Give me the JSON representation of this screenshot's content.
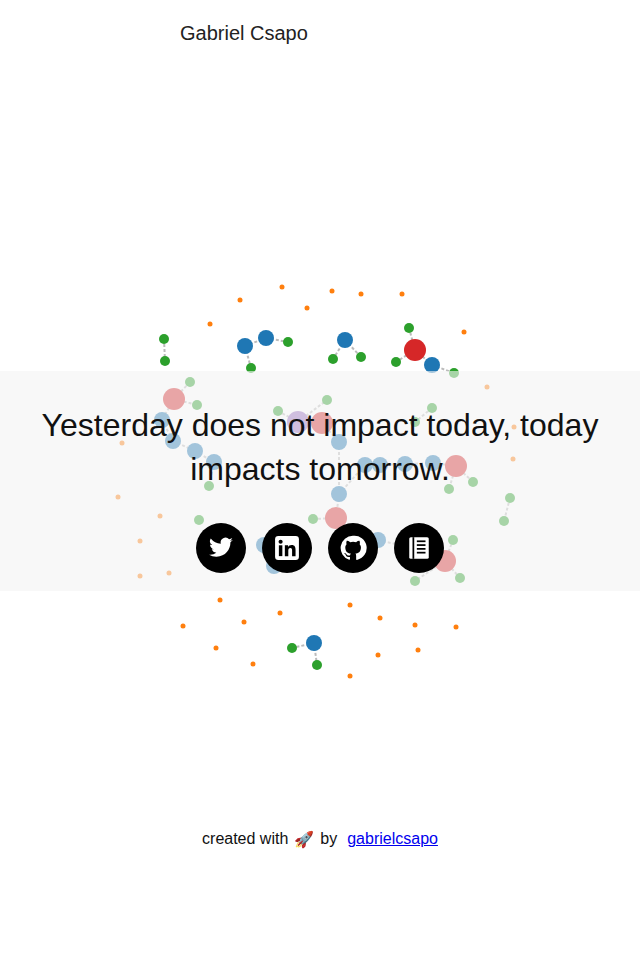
{
  "header": {
    "name": "Gabriel Csapo"
  },
  "quote": "Yesterday does not impact today, today impacts tomorrow.",
  "social": [
    {
      "network": "twitter"
    },
    {
      "network": "linkedin"
    },
    {
      "network": "github"
    },
    {
      "network": "blog"
    }
  ],
  "footer": {
    "prefix": "created with",
    "emoji": "🚀",
    "by": "by",
    "link": "gabrielcsapo"
  },
  "graph": {
    "nodes": [
      {
        "kind": "medium",
        "color": "#1f77b4"
      },
      {
        "kind": "medium",
        "color": "#1f77b4"
      },
      {
        "kind": "small",
        "color": "#2ca02c"
      },
      {
        "kind": "small",
        "color": "#2ca02c"
      },
      {
        "kind": "small",
        "color": "#2ca02c"
      },
      {
        "kind": "small",
        "color": "#2ca02c"
      },
      {
        "kind": "medium",
        "color": "#1f77b4"
      },
      {
        "kind": "small",
        "color": "#2ca02c"
      },
      {
        "kind": "small",
        "color": "#2ca02c"
      },
      {
        "kind": "large",
        "color": "#d62728"
      },
      {
        "kind": "small",
        "color": "#2ca02c"
      },
      {
        "kind": "small",
        "color": "#2ca02c"
      },
      {
        "kind": "medium",
        "color": "#1f77b4"
      },
      {
        "kind": "small",
        "color": "#2ca02c"
      },
      {
        "kind": "large",
        "color": "#d62728"
      },
      {
        "kind": "small",
        "color": "#2ca02c"
      },
      {
        "kind": "small",
        "color": "#2ca02c"
      },
      {
        "kind": "medium",
        "color": "#1f77b4"
      },
      {
        "kind": "medium",
        "color": "#1f77b4"
      },
      {
        "kind": "medium",
        "color": "#1f77b4"
      },
      {
        "kind": "medium",
        "color": "#1f77b4"
      },
      {
        "kind": "small",
        "color": "#2ca02c"
      },
      {
        "kind": "large",
        "color": "#9467bd"
      },
      {
        "kind": "small",
        "color": "#2ca02c"
      },
      {
        "kind": "small",
        "color": "#2ca02c"
      },
      {
        "kind": "large",
        "color": "#d62728"
      },
      {
        "kind": "medium",
        "color": "#1f77b4"
      },
      {
        "kind": "medium",
        "color": "#1f77b4"
      },
      {
        "kind": "medium",
        "color": "#1f77b4"
      },
      {
        "kind": "medium",
        "color": "#1f77b4"
      },
      {
        "kind": "medium",
        "color": "#1f77b4"
      },
      {
        "kind": "medium",
        "color": "#1f77b4"
      },
      {
        "kind": "large",
        "color": "#d62728"
      },
      {
        "kind": "small",
        "color": "#2ca02c"
      },
      {
        "kind": "small",
        "color": "#2ca02c"
      },
      {
        "kind": "small",
        "color": "#2ca02c"
      },
      {
        "kind": "small",
        "color": "#2ca02c"
      },
      {
        "kind": "large",
        "color": "#d62728"
      },
      {
        "kind": "small",
        "color": "#2ca02c"
      },
      {
        "kind": "medium",
        "color": "#1f77b4"
      },
      {
        "kind": "medium",
        "color": "#1f77b4"
      },
      {
        "kind": "medium",
        "color": "#1f77b4"
      },
      {
        "kind": "large",
        "color": "#d62728"
      },
      {
        "kind": "small",
        "color": "#2ca02c"
      },
      {
        "kind": "small",
        "color": "#2ca02c"
      },
      {
        "kind": "small",
        "color": "#2ca02c"
      },
      {
        "kind": "small",
        "color": "#2ca02c"
      },
      {
        "kind": "small",
        "color": "#2ca02c"
      },
      {
        "kind": "medium",
        "color": "#1f77b4"
      },
      {
        "kind": "medium",
        "color": "#1f77b4"
      },
      {
        "kind": "small",
        "color": "#2ca02c"
      },
      {
        "kind": "medium",
        "color": "#1f77b4"
      },
      {
        "kind": "small",
        "color": "#2ca02c"
      },
      {
        "kind": "small",
        "color": "#2ca02c"
      },
      {
        "kind": "dot",
        "color": "#ff7f0e"
      },
      {
        "kind": "dot",
        "color": "#ff7f0e"
      },
      {
        "kind": "dot",
        "color": "#ff7f0e"
      },
      {
        "kind": "dot",
        "color": "#ff7f0e"
      },
      {
        "kind": "dot",
        "color": "#ff7f0e"
      },
      {
        "kind": "dot",
        "color": "#ff7f0e"
      },
      {
        "kind": "dot",
        "color": "#ff7f0e"
      },
      {
        "kind": "dot",
        "color": "#ff7f0e"
      },
      {
        "kind": "dot",
        "color": "#ff7f0e"
      },
      {
        "kind": "dot",
        "color": "#ff7f0e"
      },
      {
        "kind": "dot",
        "color": "#ff7f0e"
      },
      {
        "kind": "dot",
        "color": "#ff7f0e"
      },
      {
        "kind": "dot",
        "color": "#ff7f0e"
      },
      {
        "kind": "dot",
        "color": "#ff7f0e"
      },
      {
        "kind": "dot",
        "color": "#ff7f0e"
      },
      {
        "kind": "dot",
        "color": "#ff7f0e"
      },
      {
        "kind": "dot",
        "color": "#ff7f0e"
      },
      {
        "kind": "dot",
        "color": "#ff7f0e"
      },
      {
        "kind": "dot",
        "color": "#ff7f0e"
      },
      {
        "kind": "dot",
        "color": "#ff7f0e"
      },
      {
        "kind": "dot",
        "color": "#ff7f0e"
      },
      {
        "kind": "dot",
        "color": "#ff7f0e"
      },
      {
        "kind": "dot",
        "color": "#ff7f0e"
      },
      {
        "kind": "dot",
        "color": "#ff7f0e"
      },
      {
        "kind": "dot",
        "color": "#ff7f0e"
      },
      {
        "kind": "dot",
        "color": "#ff7f0e"
      },
      {
        "kind": "dot",
        "color": "#ff7f0e"
      },
      {
        "kind": "dot",
        "color": "#ff7f0e"
      },
      {
        "kind": "dot",
        "color": "#ff7f0e"
      },
      {
        "kind": "dot",
        "color": "#ff7f0e"
      }
    ],
    "links": [
      [
        0,
        1
      ],
      [
        1,
        2
      ],
      [
        0,
        3
      ],
      [
        4,
        5
      ],
      [
        6,
        7
      ],
      [
        6,
        8
      ],
      [
        9,
        10
      ],
      [
        9,
        11
      ],
      [
        9,
        12
      ],
      [
        12,
        13
      ],
      [
        14,
        15
      ],
      [
        14,
        16
      ],
      [
        14,
        17
      ],
      [
        17,
        18
      ],
      [
        18,
        19
      ],
      [
        19,
        20
      ],
      [
        20,
        21
      ],
      [
        22,
        23
      ],
      [
        22,
        24
      ],
      [
        22,
        25
      ],
      [
        25,
        26
      ],
      [
        26,
        27
      ],
      [
        27,
        28
      ],
      [
        28,
        29
      ],
      [
        29,
        30
      ],
      [
        30,
        31
      ],
      [
        31,
        32
      ],
      [
        32,
        33
      ],
      [
        32,
        34
      ],
      [
        35,
        36
      ],
      [
        27,
        37
      ],
      [
        37,
        38
      ],
      [
        37,
        39
      ],
      [
        39,
        40
      ],
      [
        40,
        41
      ],
      [
        41,
        42
      ],
      [
        42,
        43
      ],
      [
        42,
        44
      ],
      [
        42,
        45
      ],
      [
        46,
        47
      ],
      [
        48,
        49
      ],
      [
        51,
        52
      ],
      [
        51,
        53
      ]
    ]
  }
}
